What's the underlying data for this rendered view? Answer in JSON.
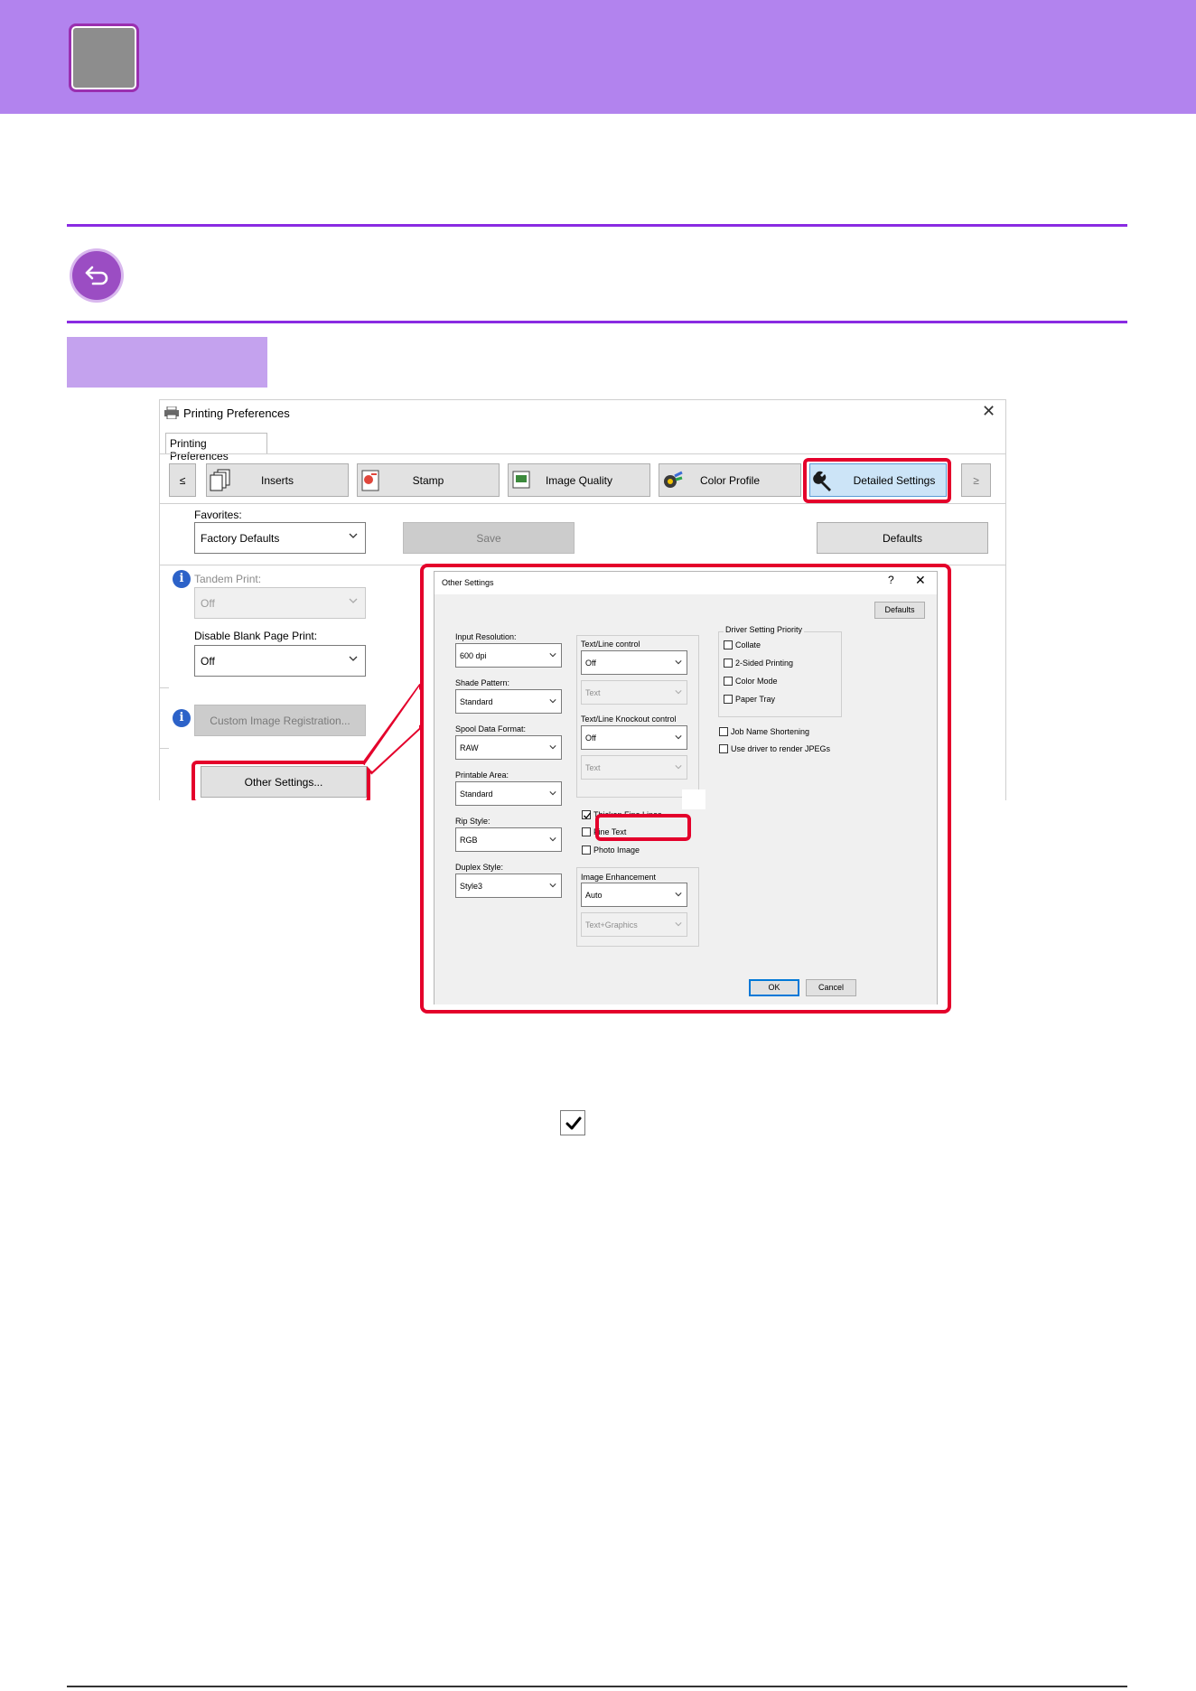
{
  "colors": {
    "banner": "#b283ee",
    "rule": "#8a2be2",
    "highlight": "#e4002b",
    "step_bar": "#c4a2ee"
  },
  "icons": {
    "back": "back-arrow-icon",
    "check": "checkmark-icon",
    "printer": "printer-icon",
    "info": "info-icon",
    "wrench": "wrench-icon"
  },
  "printing_preferences": {
    "title": "Printing Preferences",
    "tab_label": "Printing Preferences",
    "nav_prev": "≤",
    "nav_next": "≥",
    "tabs": [
      {
        "label": "Inserts",
        "icon": "inserts-icon"
      },
      {
        "label": "Stamp",
        "icon": "stamp-icon"
      },
      {
        "label": "Image Quality",
        "icon": "image-quality-icon"
      },
      {
        "label": "Color Profile",
        "icon": "color-profile-icon"
      },
      {
        "label": "Detailed Settings",
        "icon": "wrench-icon",
        "selected": true
      }
    ],
    "favorites_label": "Favorites:",
    "favorites_value": "Factory Defaults",
    "save_button": "Save",
    "defaults_button": "Defaults",
    "tandem_print_label": "Tandem Print:",
    "tandem_print_value": "Off",
    "disable_blank_label": "Disable Blank Page Print:",
    "disable_blank_value": "Off",
    "custom_image_button": "Custom Image Registration...",
    "other_settings_button": "Other Settings..."
  },
  "other_settings": {
    "title": "Other Settings",
    "help": "?",
    "close": "✕",
    "defaults_button": "Defaults",
    "input_resolution_label": "Input Resolution:",
    "input_resolution_value": "600 dpi",
    "shade_pattern_label": "Shade Pattern:",
    "shade_pattern_value": "Standard",
    "spool_format_label": "Spool Data Format:",
    "spool_format_value": "RAW",
    "printable_area_label": "Printable Area:",
    "printable_area_value": "Standard",
    "rip_style_label": "Rip Style:",
    "rip_style_value": "RGB",
    "duplex_style_label": "Duplex Style:",
    "duplex_style_value": "Style3",
    "text_line_control_label": "Text/Line control",
    "text_line_control_value": "Off",
    "text_line_control_sub": "Text",
    "knockout_label": "Text/Line Knockout control",
    "knockout_value": "Off",
    "knockout_sub": "Text",
    "thicken_fine_lines": "Thicken Fine Lines",
    "fine_text": "Fine Text",
    "photo_image": "Photo Image",
    "image_enhancement_label": "Image Enhancement",
    "image_enhancement_value": "Auto",
    "image_enhancement_sub": "Text+Graphics",
    "driver_priority_label": "Driver Setting Priority",
    "priority_items": [
      "Collate",
      "2-Sided Printing",
      "Color Mode",
      "Paper Tray"
    ],
    "job_name_shortening": "Job Name Shortening",
    "use_driver_jpeg": "Use driver to render JPEGs",
    "ok_button": "OK",
    "cancel_button": "Cancel"
  }
}
